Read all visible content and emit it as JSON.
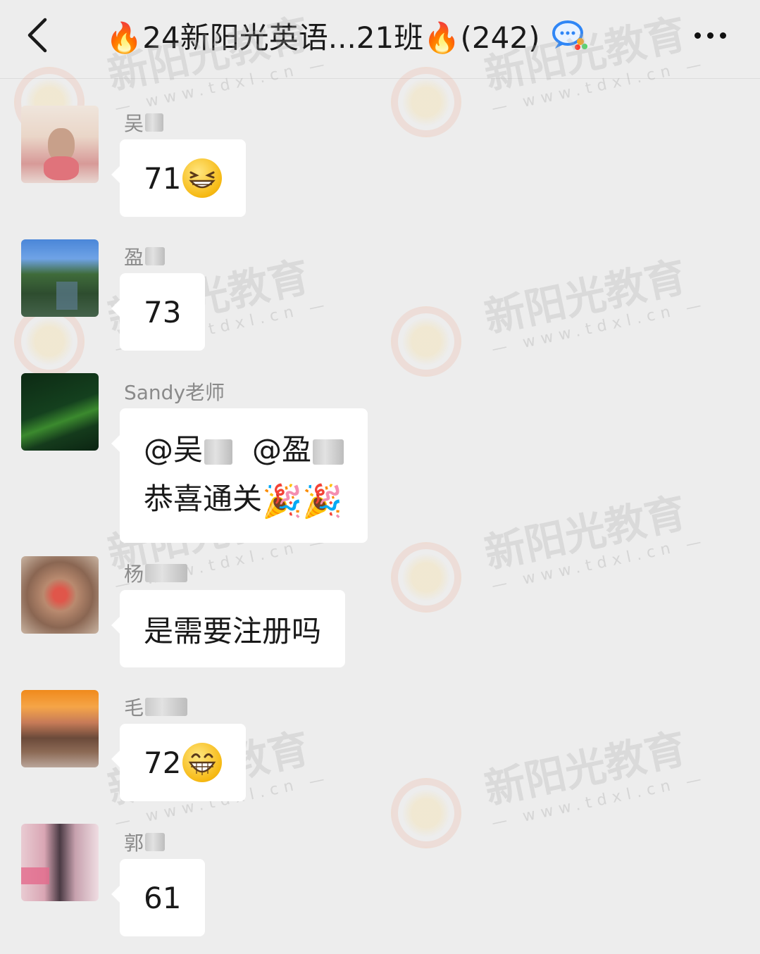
{
  "header": {
    "title": "🔥24新阳光英语...21班🔥(242)",
    "back_icon": "chevron-left-icon",
    "more_icon": "more-icon"
  },
  "watermark": {
    "brand": "新阳光教育",
    "url": "— www.tdxl.cn —"
  },
  "messages": [
    {
      "sender": "吴",
      "text": "71",
      "emoji": "grinning-squint-emoji"
    },
    {
      "sender": "盈",
      "text": "73"
    },
    {
      "sender": "Sandy老师",
      "line1": "@吴",
      "line1b": "@盈",
      "line2": "恭喜通关",
      "emoji": "🎉🎉"
    },
    {
      "sender": "杨",
      "text": "是需要注册吗"
    },
    {
      "sender": "毛",
      "text": "72",
      "emoji": "grinning-emoji"
    },
    {
      "sender": "郭",
      "text": "61"
    }
  ],
  "colors": {
    "background": "#ededed",
    "bubble": "#ffffff",
    "name": "#8a8a8a"
  }
}
